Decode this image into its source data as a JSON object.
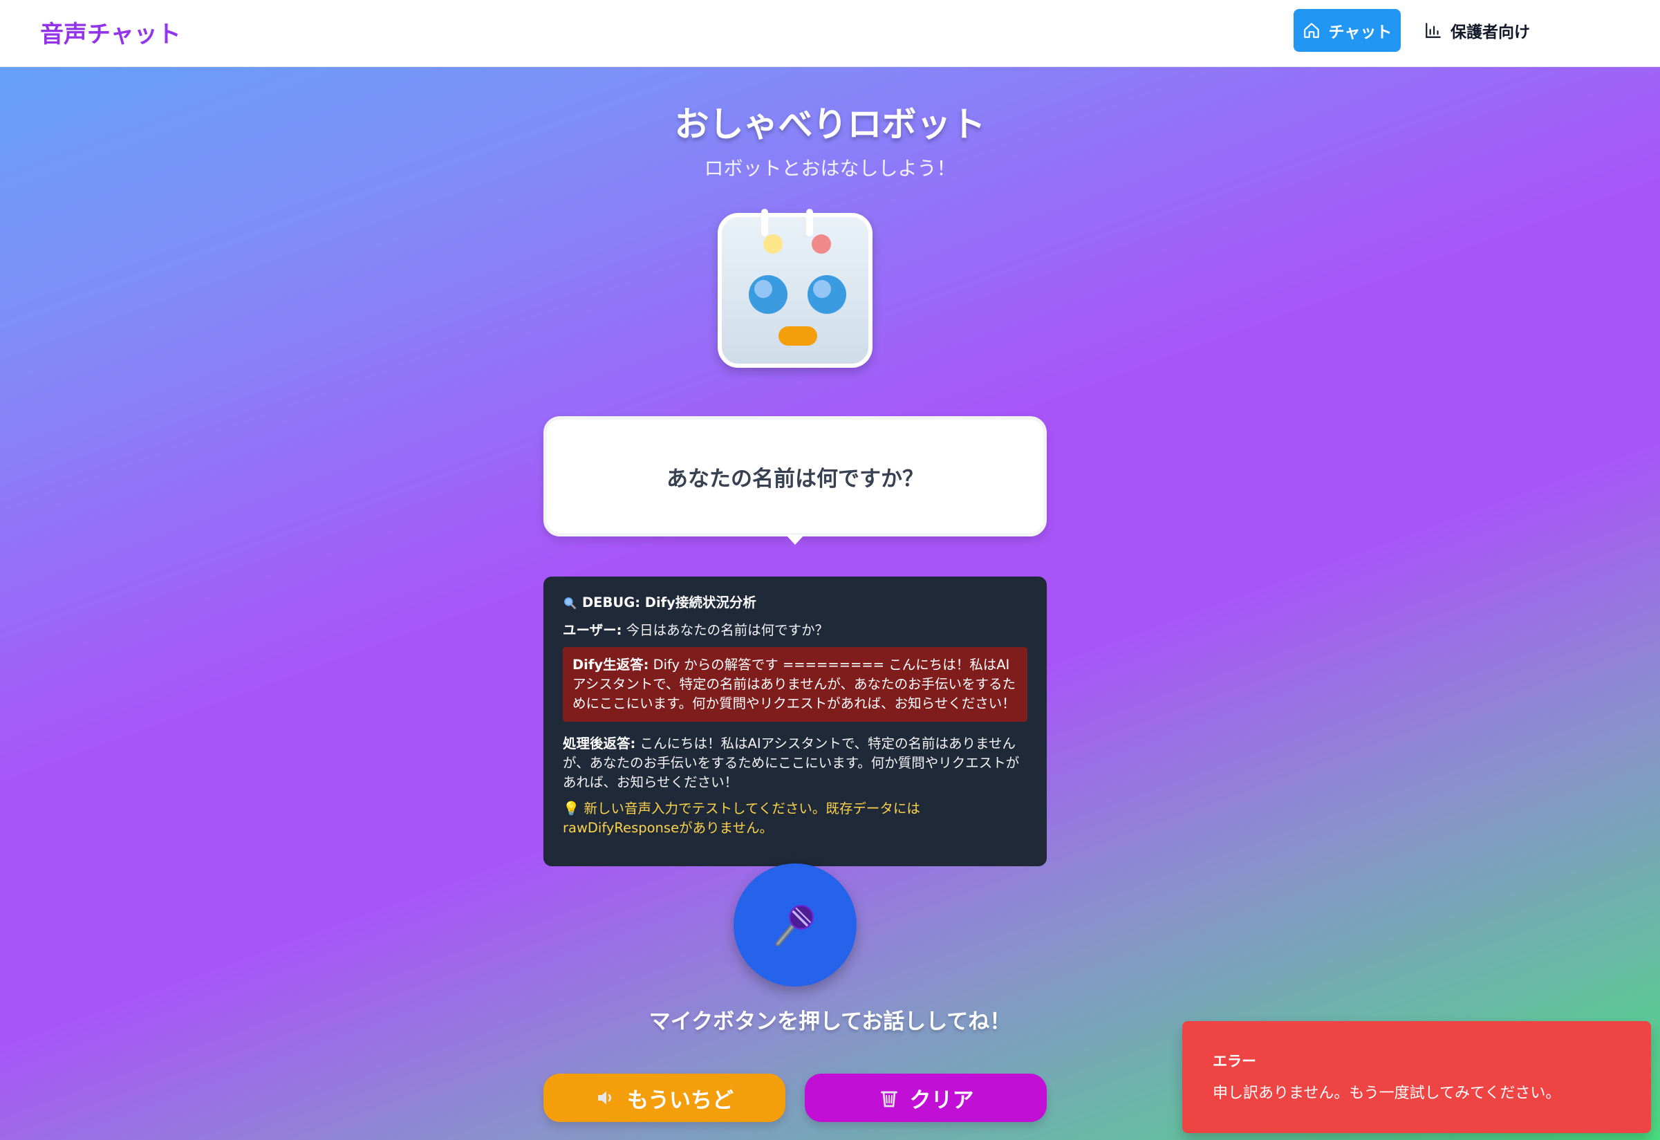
{
  "header": {
    "brand": "音声チャット",
    "nav_chat_label": "チャット",
    "nav_parent_label": "保護者向け",
    "icons": [
      "home-icon",
      "bar-chart-icon"
    ]
  },
  "hero": {
    "title": "おしゃべりロボット",
    "subtitle": "ロボットとおはなししよう！"
  },
  "robot": {
    "colors": {
      "face": "#dbe7f1",
      "eyes": "#3b9be0",
      "mouth": "#f59e0b",
      "light_left": "#fde68a",
      "light_right": "#f08a8a"
    }
  },
  "bubble": {
    "text": "あなたの名前は何ですか？"
  },
  "debug": {
    "icon": "magnifier-icon",
    "title": "DEBUG: Dify接続状況分析",
    "user_label": "ユーザー:",
    "user_text": "今日はあなたの名前は何ですか？",
    "raw_label": "Dify生返答:",
    "raw_text": "Dify からの解答です ========= こんにちは！私はAIアシスタントで、特定の名前はありませんが、あなたのお手伝いをするためにここにいます。何か質問やリクエストがあれば、お知らせください！",
    "processed_label": "処理後返答:",
    "processed_text": "こんにちは！私はAIアシスタントで、特定の名前はありませんが、あなたのお手伝いをするためにここにいます。何か質問やリクエストがあれば、お知らせください！",
    "hint_icon": "lightbulb-icon",
    "hint_text": "新しい音声入力でテストしてください。既存データにはrawDifyResponseがありません。"
  },
  "mic": {
    "icon": "microphone-icon"
  },
  "prompt": "マイクボタンを押してお話ししてね！",
  "buttons": {
    "again_icon": "speaker-icon",
    "again_label": "もういちど",
    "clear_icon": "trash-icon",
    "clear_label": "クリア"
  },
  "toast": {
    "title": "エラー",
    "message": "申し訳ありません。もう一度試してみてください。",
    "color": "#ef4444"
  }
}
